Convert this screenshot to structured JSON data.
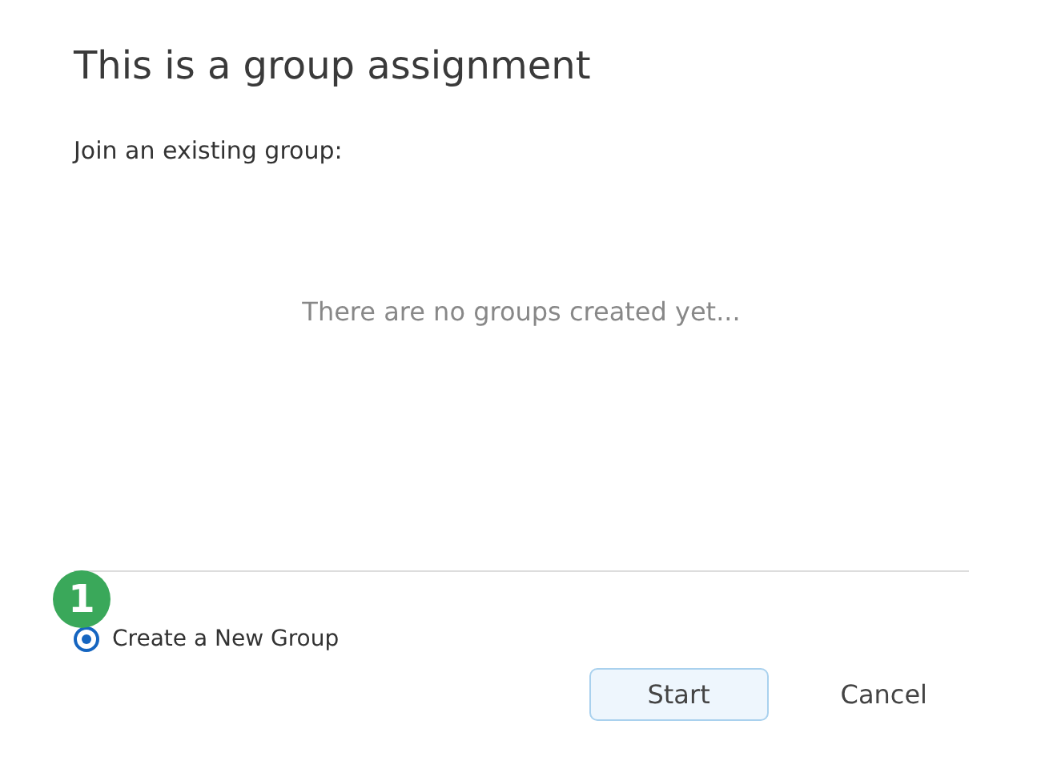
{
  "title": "This is a group assignment",
  "join_label": "Join an existing group:",
  "empty_message": "There are no groups created yet...",
  "callout": {
    "label": "1",
    "color": "#3aa85a"
  },
  "options": [
    {
      "label": "Create a New Group",
      "selected": true
    }
  ],
  "buttons": [
    {
      "label": "Start",
      "kind": "primary"
    },
    {
      "label": "Cancel",
      "kind": "plain"
    }
  ]
}
